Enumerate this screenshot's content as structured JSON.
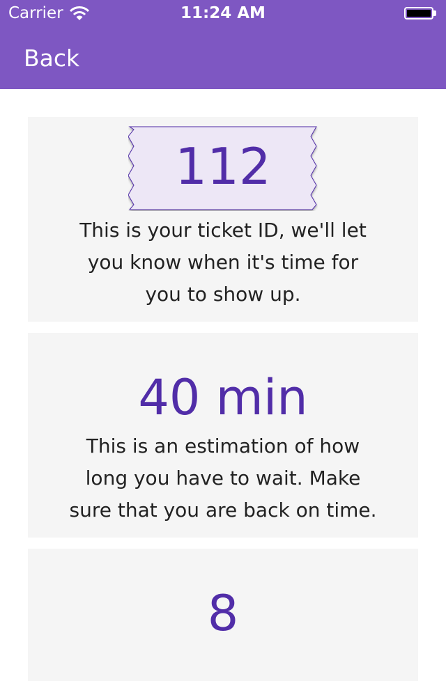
{
  "status_bar": {
    "carrier": "Carrier",
    "time": "11:24 AM"
  },
  "nav": {
    "back_label": "Back"
  },
  "ticket_card": {
    "ticket_id": "112",
    "description": "This is your ticket ID, we'll let\nyou know when it's time for\nyou to show up."
  },
  "wait_card": {
    "value": "40 min",
    "description": "This is an estimation of how\nlong you have to wait. Make\nsure that you are back on time."
  },
  "third_card": {
    "value": "8"
  },
  "colors": {
    "header": "#7e57c2",
    "accent": "#512da8",
    "card_background": "#f5f5f5"
  }
}
